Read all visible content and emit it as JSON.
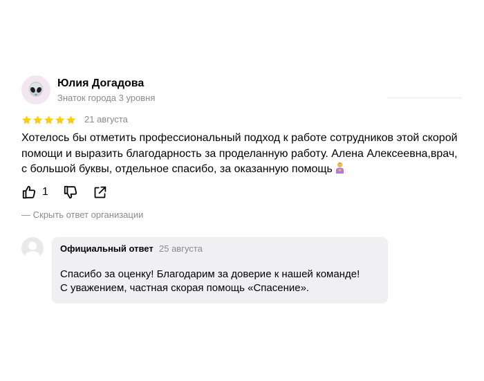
{
  "review": {
    "author": {
      "name": "Юлия Догадова",
      "level": "Знаток города 3 уровня",
      "avatar_icon": "alien-icon"
    },
    "rating": 5,
    "rating_max": 5,
    "star_color": "#fc0",
    "date": "21 августа",
    "text_lines": [
      "Хотелось бы отметить профессиональный подход к работе сотрудников этой скорой",
      "помощи и выразить благодарность за проделанную работу. Алена Алексеевна,врач,",
      "с большой буквы, отдельное спасибо, за оказанную помощь"
    ],
    "text_emoji": "person-bowing-emoji",
    "actions": {
      "like_icon": "thumbs-up-icon",
      "like_count": "1",
      "dislike_icon": "thumbs-down-icon",
      "share_icon": "share-icon"
    },
    "toggle_reply_label": "— Скрыть ответ организации"
  },
  "official_reply": {
    "avatar_icon": "user-placeholder-icon",
    "label": "Официальный ответ",
    "date": "25 августа",
    "text_lines": [
      "Спасибо за оценку! Благодарим за доверие к нашей команде!",
      "С уважением, частная скорая помощь «Спасение»."
    ]
  }
}
